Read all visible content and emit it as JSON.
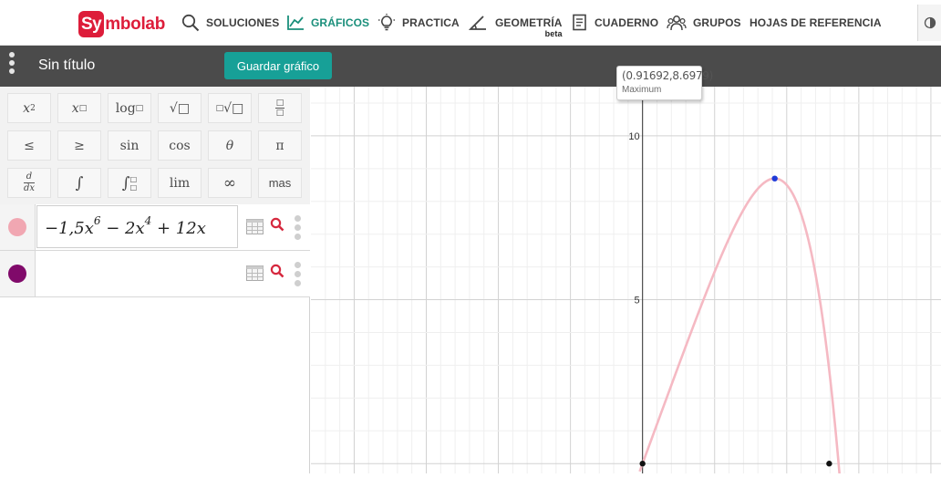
{
  "brand": {
    "prefix": "Sy",
    "rest": "mbolab",
    "color": "#dd1d3a"
  },
  "nav": {
    "soluciones": "SOLUCIONES",
    "graficos": "GRÁFICOS",
    "practica": "PRACTICA",
    "geometria": "GEOMETRÍA",
    "geometria_badge": "beta",
    "cuaderno": "CUADERNO",
    "grupos": "GRUPOS",
    "hojas": "HOJAS DE REFERENCIA",
    "active": "graficos",
    "active_color": "#1a8f7b"
  },
  "header": {
    "title": "Sin título",
    "save_label": "Guardar gráfico",
    "save_color": "#17a097"
  },
  "keypad": {
    "row1": [
      "x²",
      "x□",
      "log□",
      "√□",
      "□√□",
      "□/□"
    ],
    "row2": [
      "≤",
      "≥",
      "sin",
      "cos",
      "θ",
      "π"
    ],
    "row3": [
      "d/dx",
      "∫",
      "∫□□",
      "lim",
      "∞",
      "mas"
    ]
  },
  "expressions": [
    {
      "color": "#f1a7b2",
      "latex": "−1,5x⁶ − 2x⁴ + 12x",
      "coef": "−1,5x",
      "e1": "6",
      "mid": " − 2x",
      "e2": "4",
      "tail": " + 12x"
    },
    {
      "color": "#800a6a",
      "latex": ""
    }
  ],
  "graph": {
    "curve_color": "#f5b9c3",
    "y_ticks": [
      "10",
      "5"
    ],
    "tooltip_coords": "(0.91692,8.6979)",
    "tooltip_label": "Maximum"
  },
  "chart_data": {
    "type": "line",
    "title": "",
    "xlabel": "",
    "ylabel": "",
    "function": "-1.5x^6 - 2x^4 + 12x",
    "series": [
      {
        "x": [
          0,
          0.1,
          0.2,
          0.3,
          0.4,
          0.5,
          0.6,
          0.7,
          0.8,
          0.9,
          0.91692,
          1.0,
          1.1,
          1.2,
          1.3,
          1.37
        ],
        "values": [
          0,
          1.1998,
          2.3967,
          3.5827,
          4.7427,
          5.8516,
          6.8606,
          7.6435,
          8.1876,
          8.6867,
          8.6979,
          8.5,
          7.37,
          4.56,
          -0.21,
          -4.0
        ]
      }
    ],
    "points": [
      {
        "label": "Maximum",
        "x": 0.91692,
        "y": 8.6979
      },
      {
        "label": "root",
        "x": 0,
        "y": 0
      },
      {
        "label": "root",
        "x": 1.2945,
        "y": 0
      }
    ],
    "ylim": [
      -0.3,
      11.5
    ],
    "xlim": [
      -2.3,
      2.07
    ],
    "grid": true
  }
}
